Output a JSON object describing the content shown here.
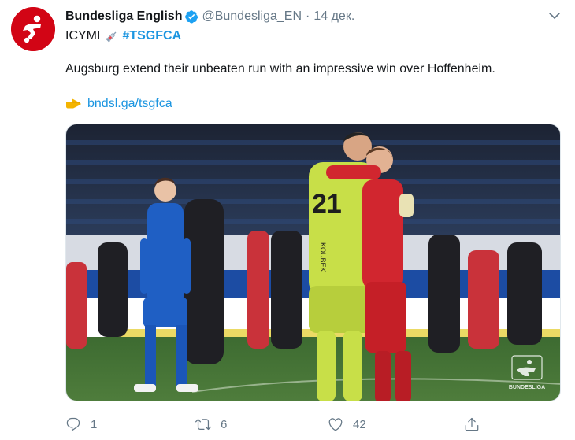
{
  "tweet": {
    "display_name": "Bundesliga English",
    "handle": "@Bundesliga_EN",
    "separator": "·",
    "date": "14 дек.",
    "icymi": "ICYMI",
    "hashtag": "#TSGFCA",
    "text": "Augsburg extend their unbeaten run with an impressive win over Hoffenheim.",
    "link": "bndsl.ga/tsgfca"
  },
  "media": {
    "alt": "Photo of players celebrating on the pitch",
    "shirt_number": "21",
    "shirt_name": "KOUBEK",
    "watermark": "BUNDESLIGA"
  },
  "actions": {
    "reply_count": "1",
    "retweet_count": "6",
    "like_count": "42"
  },
  "icons": {
    "verified": "verified-badge-icon",
    "caret": "chevron-down-icon",
    "syringe": "syringe-emoji",
    "pointing": "pointing-hand-emoji",
    "reply": "reply-icon",
    "retweet": "retweet-icon",
    "like": "heart-icon",
    "share": "share-icon"
  },
  "colors": {
    "brand_red": "#d20515",
    "link_blue": "#1b95e0",
    "muted": "#657786"
  }
}
